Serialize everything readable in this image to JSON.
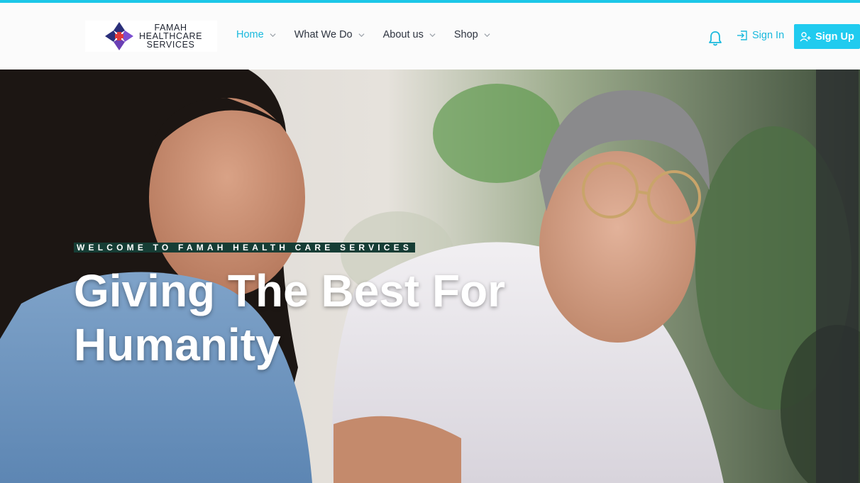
{
  "brand": {
    "line1": "FAMAH",
    "line2": "HEALTHCARE",
    "line3": "SERVICES",
    "accent_color": "#1cc7e8",
    "signup_color": "#20cbef",
    "eyebrow_bg": "#163d35"
  },
  "nav": {
    "items": [
      {
        "label": "Home",
        "active": true
      },
      {
        "label": "What We Do"
      },
      {
        "label": "About us"
      },
      {
        "label": "Shop"
      }
    ]
  },
  "actions": {
    "notification_icon": "bell-icon",
    "sign_in": "Sign In",
    "sign_up": "Sign Up"
  },
  "hero": {
    "eyebrow": "WELCOME TO FAMAH HEALTH CARE SERVICES",
    "title": "Giving The Best For Humanity"
  }
}
